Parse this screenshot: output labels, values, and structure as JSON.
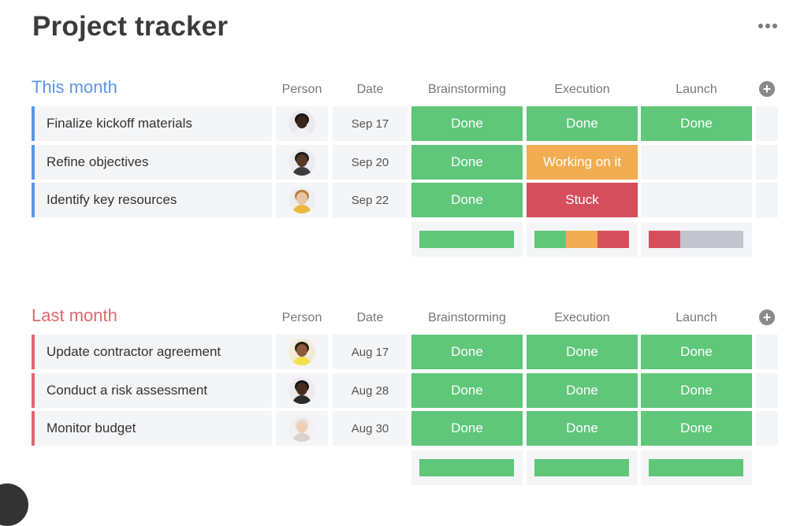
{
  "page": {
    "title": "Project tracker",
    "more_icon": "more-horizontal-icon"
  },
  "colors": {
    "done": "#5fc67a",
    "working": "#f2ac52",
    "stuck": "#d54e5c",
    "empty": "#c4c5cf",
    "this_month_accent": "#5c95e5",
    "last_month_accent": "#e2666f",
    "cell_background": "#f4f5f7"
  },
  "columns": {
    "person": "Person",
    "date": "Date",
    "brainstorming": "Brainstorming",
    "execution": "Execution",
    "launch": "Launch",
    "add_icon": "plus-circle-icon"
  },
  "groups": [
    {
      "title": "This month",
      "accent": "#5c95e5",
      "rows": [
        {
          "name": "Finalize kickoff materials",
          "date": "Sep 17",
          "person": {
            "icon": "person-avatar",
            "skin": "#3a2318",
            "hair": "#141414",
            "shirt": "#f2f2f2",
            "bg": "#e9e9ee"
          },
          "brainstorming": "Done",
          "execution": "Done",
          "launch": "Done"
        },
        {
          "name": "Refine objectives",
          "date": "Sep 20",
          "person": {
            "icon": "person-avatar",
            "skin": "#5a3726",
            "hair": "#1d1d1d",
            "shirt": "#3c3c3c",
            "bg": "#ececef"
          },
          "brainstorming": "Done",
          "execution": "Working on it",
          "launch": ""
        },
        {
          "name": "Identify key resources",
          "date": "Sep 22",
          "person": {
            "icon": "person-avatar",
            "skin": "#eac5a5",
            "hair": "#b9823d",
            "shirt": "#e9b93c",
            "bg": "#efeff2"
          },
          "brainstorming": "Done",
          "execution": "Stuck",
          "launch": ""
        }
      ],
      "summary": {
        "brainstorming": {
          "done": 1.0
        },
        "execution": {
          "done": 0.333,
          "working": 0.333,
          "stuck": 0.333
        },
        "launch": {
          "stuck": 0.333,
          "empty": 0.667
        }
      }
    },
    {
      "title": "Last month",
      "accent": "#e2666f",
      "rows": [
        {
          "name": "Update contractor agreement",
          "date": "Aug 17",
          "person": {
            "icon": "person-avatar",
            "skin": "#8a5a3c",
            "hair": "#2a1c12",
            "shirt": "#f4e04d",
            "bg": "#f0ecd8"
          },
          "brainstorming": "Done",
          "execution": "Done",
          "launch": "Done"
        },
        {
          "name": "Conduct a risk assessment",
          "date": "Aug 28",
          "person": {
            "icon": "person-avatar",
            "skin": "#4a2c1e",
            "hair": "#151515",
            "shirt": "#2b2b2b",
            "bg": "#ebebee"
          },
          "brainstorming": "Done",
          "execution": "Done",
          "launch": "Done"
        },
        {
          "name": "Monitor budget",
          "date": "Aug 30",
          "person": {
            "icon": "person-avatar",
            "skin": "#f0cfb8",
            "hair": "#e9e4de",
            "shirt": "#d9d3cc",
            "bg": "#f1f1f3"
          },
          "brainstorming": "Done",
          "execution": "Done",
          "launch": "Done"
        }
      ],
      "summary": {
        "brainstorming": {
          "done": 1.0
        },
        "execution": {
          "done": 1.0
        },
        "launch": {
          "done": 1.0
        }
      }
    }
  ]
}
